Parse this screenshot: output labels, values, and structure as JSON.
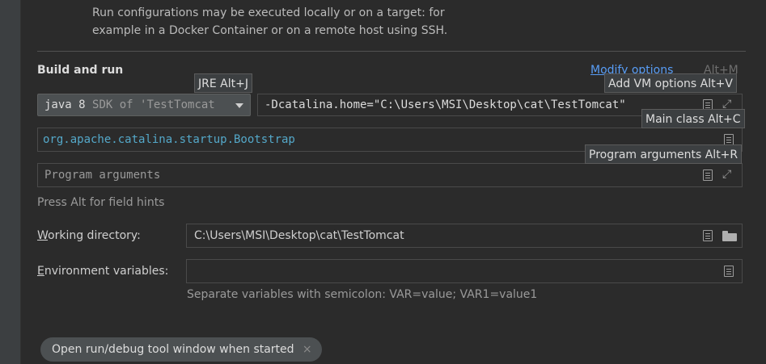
{
  "description": {
    "line1": "Run configurations may be executed locally or on a target: for",
    "line2": "example in a Docker Container or on a remote host using SSH."
  },
  "build_and_run": {
    "title": "Build and run",
    "modify_options": "Modify options",
    "modify_shortcut": "Alt+M",
    "jre_tooltip": "JRE Alt+J",
    "jre_value": "java 8",
    "jre_sdk": "SDK of 'TestTomcat",
    "vm_options_value": "-Dcatalina.home=\"C:\\Users\\MSI\\Desktop\\cat\\TestTomcat\"",
    "vm_tooltip": "Add VM options Alt+V",
    "main_class_value": "org.apache.catalina.startup.Bootstrap",
    "main_class_tooltip": "Main class Alt+C",
    "program_args_placeholder": "Program arguments",
    "program_args_tooltip": "Program arguments Alt+R",
    "field_hint": "Press Alt for field hints"
  },
  "working_directory": {
    "mnemonic": "W",
    "label_rest": "orking directory:",
    "value": "C:\\Users\\MSI\\Desktop\\cat\\TestTomcat"
  },
  "environment_variables": {
    "mnemonic": "E",
    "label_rest": "nvironment variables:",
    "value": "",
    "hint": "Separate variables with semicolon: VAR=value; VAR1=value1"
  },
  "option_chip": {
    "label": "Open run/debug tool window when started",
    "close": "×"
  },
  "icons": {
    "dropdown": "chevron-down-icon",
    "expand": "expand-icon",
    "edit": "document-icon",
    "browse": "folder-icon"
  },
  "colors": {
    "background": "#2b2b2b",
    "link": "#589df6",
    "main_class": "#54a8c9",
    "chip": "#4c5052"
  }
}
